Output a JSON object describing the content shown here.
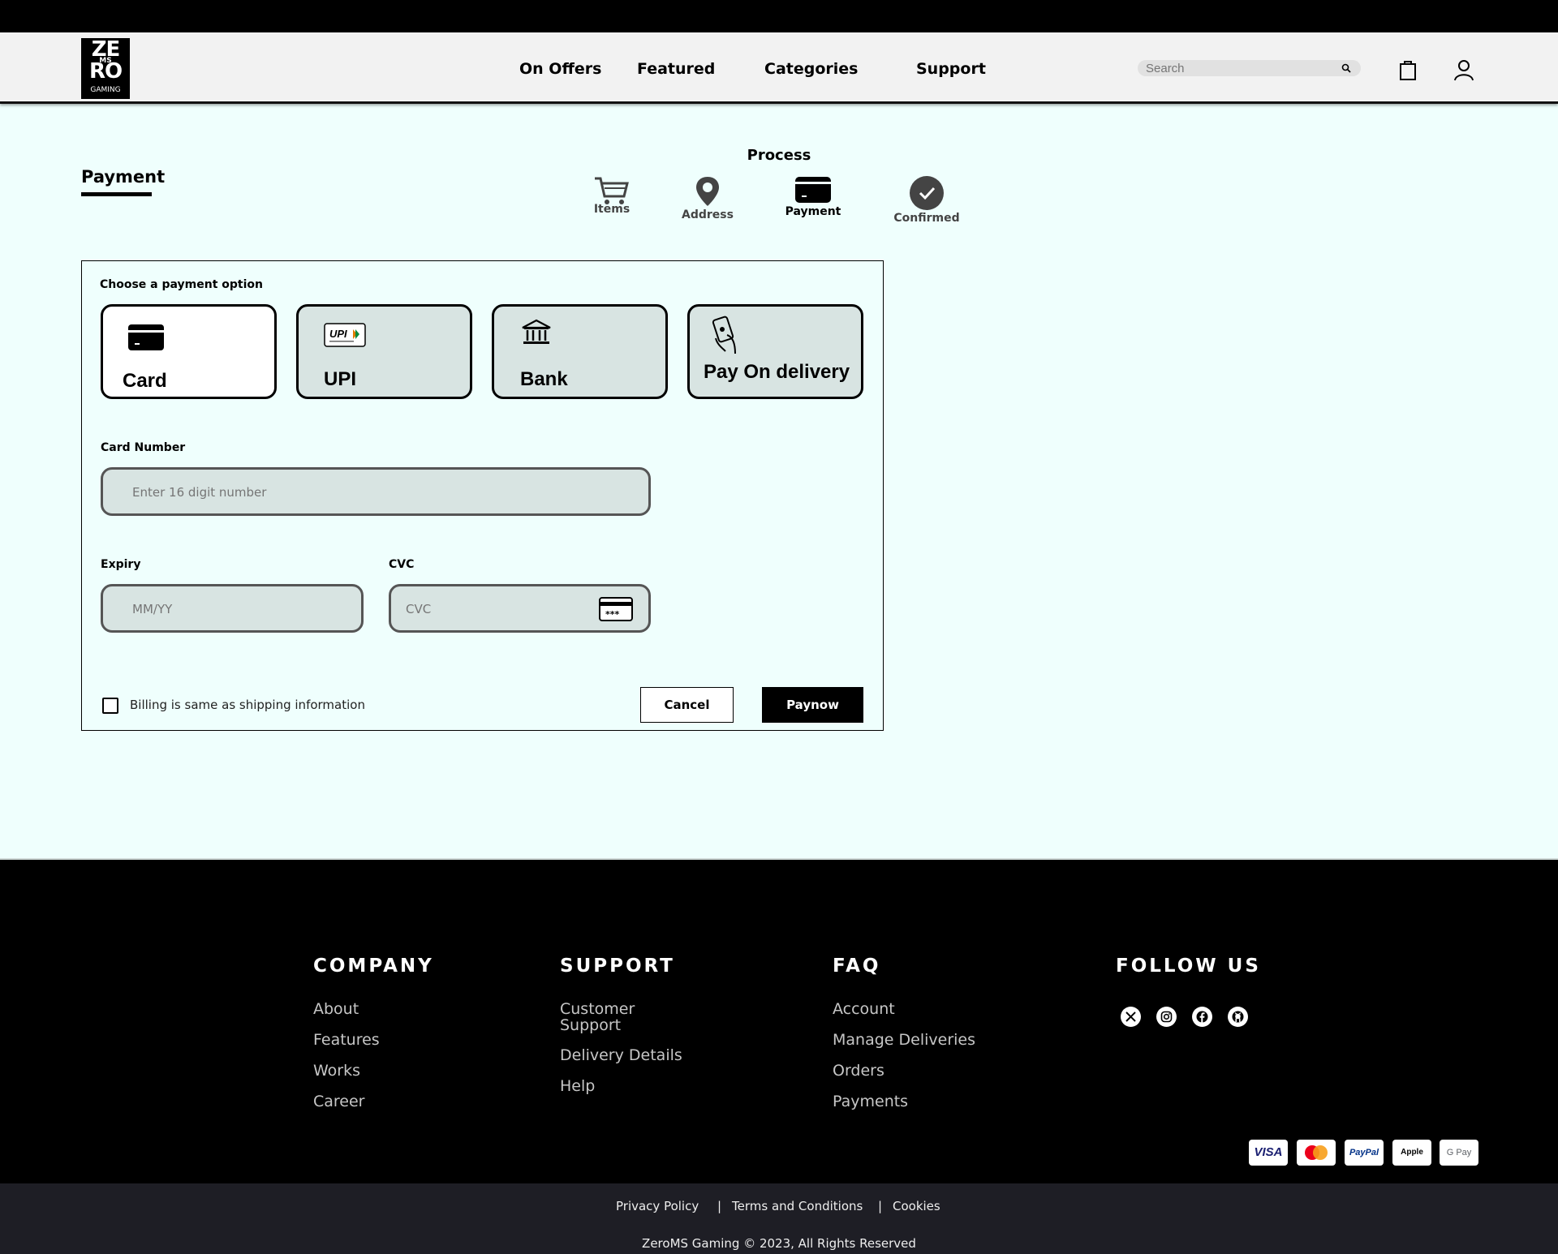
{
  "brand": {
    "logo_line1": "ZE",
    "logo_line2": "MS",
    "logo_line3": "RO",
    "logo_line4": "GAMING"
  },
  "nav": {
    "on_offers": "On Offers",
    "featured": "Featured",
    "categories": "Categories",
    "support": "Support"
  },
  "search": {
    "placeholder": "Search",
    "icon": "search-icon"
  },
  "header_icons": [
    "cart-bag-icon",
    "user-icon"
  ],
  "page": {
    "title": "Payment"
  },
  "process": {
    "title": "Process",
    "steps": [
      {
        "label": "Items",
        "icon": "cart-icon"
      },
      {
        "label": "Address",
        "icon": "location-pin-icon"
      },
      {
        "label": "Payment",
        "icon": "card-icon",
        "active": true
      },
      {
        "label": "Confirmed",
        "icon": "check-circle-icon"
      }
    ]
  },
  "payment": {
    "choose_label": "Choose a payment option",
    "options": [
      {
        "label": "Card",
        "icon": "card-icon",
        "selected": true
      },
      {
        "label": "UPI",
        "icon": "upi-logo-icon"
      },
      {
        "label": "Bank",
        "icon": "bank-icon"
      },
      {
        "label": "Pay On delivery",
        "icon": "hand-cash-icon"
      }
    ],
    "card_number": {
      "label": "Card Number",
      "placeholder": "Enter 16 digit number"
    },
    "expiry": {
      "label": "Expiry",
      "placeholder": "MM/YY"
    },
    "cvc": {
      "label": "CVC",
      "placeholder": "CVC",
      "icon": "card-cvc-icon"
    },
    "billing_same_label": "Billing is same as shipping information",
    "billing_same_checked": false,
    "cancel_label": "Cancel",
    "pay_label": "Paynow"
  },
  "footer": {
    "company": {
      "title": "COMPANY",
      "links": [
        "About",
        "Features",
        "Works",
        "Career"
      ]
    },
    "support": {
      "title": "SUPPORT",
      "links": [
        "Customer Support",
        "Delivery Details",
        "Help"
      ]
    },
    "faq": {
      "title": "FAQ",
      "links": [
        "Account",
        "Manage Deliveries",
        "Orders",
        "Payments"
      ]
    },
    "follow": {
      "title": "FOLLOW US",
      "icons": [
        "x-twitter-icon",
        "instagram-icon",
        "facebook-icon",
        "github-icon"
      ]
    },
    "payment_cards": [
      "VISA",
      "Mastercard",
      "PayPal",
      "Apple Pay",
      "G Pay"
    ]
  },
  "bottom": {
    "privacy": "Privacy Policy",
    "terms": "Terms and Conditions",
    "cookies": "Cookies",
    "separator": "|",
    "copyright": "ZeroMS Gaming © 2023, All Rights Reserved"
  }
}
